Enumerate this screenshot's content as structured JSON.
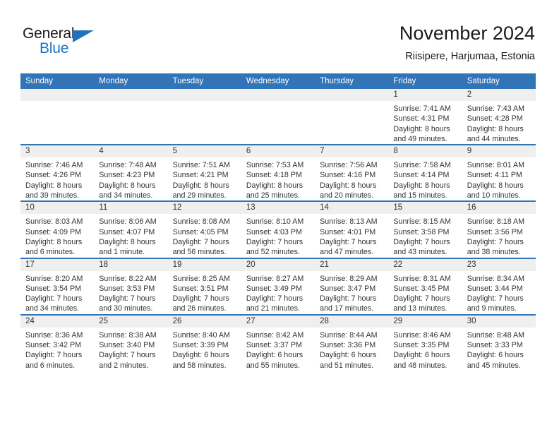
{
  "brand": {
    "name_part1": "General",
    "name_part2": "Blue",
    "triangle_color": "#1e73be"
  },
  "header": {
    "title": "November 2024",
    "subtitle": "Riisipere, Harjumaa, Estonia",
    "header_bg_color": "#3174b8",
    "daynum_band_color": "#efefef"
  },
  "weekday_headers": [
    "Sunday",
    "Monday",
    "Tuesday",
    "Wednesday",
    "Thursday",
    "Friday",
    "Saturday"
  ],
  "weeks": [
    [
      {
        "day": "",
        "empty": true
      },
      {
        "day": "",
        "empty": true
      },
      {
        "day": "",
        "empty": true
      },
      {
        "day": "",
        "empty": true
      },
      {
        "day": "",
        "empty": true
      },
      {
        "day": "1",
        "sunrise": "Sunrise: 7:41 AM",
        "sunset": "Sunset: 4:31 PM",
        "daylight_line1": "Daylight: 8 hours",
        "daylight_line2": "and 49 minutes."
      },
      {
        "day": "2",
        "sunrise": "Sunrise: 7:43 AM",
        "sunset": "Sunset: 4:28 PM",
        "daylight_line1": "Daylight: 8 hours",
        "daylight_line2": "and 44 minutes."
      }
    ],
    [
      {
        "day": "3",
        "sunrise": "Sunrise: 7:46 AM",
        "sunset": "Sunset: 4:26 PM",
        "daylight_line1": "Daylight: 8 hours",
        "daylight_line2": "and 39 minutes."
      },
      {
        "day": "4",
        "sunrise": "Sunrise: 7:48 AM",
        "sunset": "Sunset: 4:23 PM",
        "daylight_line1": "Daylight: 8 hours",
        "daylight_line2": "and 34 minutes."
      },
      {
        "day": "5",
        "sunrise": "Sunrise: 7:51 AM",
        "sunset": "Sunset: 4:21 PM",
        "daylight_line1": "Daylight: 8 hours",
        "daylight_line2": "and 29 minutes."
      },
      {
        "day": "6",
        "sunrise": "Sunrise: 7:53 AM",
        "sunset": "Sunset: 4:18 PM",
        "daylight_line1": "Daylight: 8 hours",
        "daylight_line2": "and 25 minutes."
      },
      {
        "day": "7",
        "sunrise": "Sunrise: 7:56 AM",
        "sunset": "Sunset: 4:16 PM",
        "daylight_line1": "Daylight: 8 hours",
        "daylight_line2": "and 20 minutes."
      },
      {
        "day": "8",
        "sunrise": "Sunrise: 7:58 AM",
        "sunset": "Sunset: 4:14 PM",
        "daylight_line1": "Daylight: 8 hours",
        "daylight_line2": "and 15 minutes."
      },
      {
        "day": "9",
        "sunrise": "Sunrise: 8:01 AM",
        "sunset": "Sunset: 4:11 PM",
        "daylight_line1": "Daylight: 8 hours",
        "daylight_line2": "and 10 minutes."
      }
    ],
    [
      {
        "day": "10",
        "sunrise": "Sunrise: 8:03 AM",
        "sunset": "Sunset: 4:09 PM",
        "daylight_line1": "Daylight: 8 hours",
        "daylight_line2": "and 6 minutes."
      },
      {
        "day": "11",
        "sunrise": "Sunrise: 8:06 AM",
        "sunset": "Sunset: 4:07 PM",
        "daylight_line1": "Daylight: 8 hours",
        "daylight_line2": "and 1 minute."
      },
      {
        "day": "12",
        "sunrise": "Sunrise: 8:08 AM",
        "sunset": "Sunset: 4:05 PM",
        "daylight_line1": "Daylight: 7 hours",
        "daylight_line2": "and 56 minutes."
      },
      {
        "day": "13",
        "sunrise": "Sunrise: 8:10 AM",
        "sunset": "Sunset: 4:03 PM",
        "daylight_line1": "Daylight: 7 hours",
        "daylight_line2": "and 52 minutes."
      },
      {
        "day": "14",
        "sunrise": "Sunrise: 8:13 AM",
        "sunset": "Sunset: 4:01 PM",
        "daylight_line1": "Daylight: 7 hours",
        "daylight_line2": "and 47 minutes."
      },
      {
        "day": "15",
        "sunrise": "Sunrise: 8:15 AM",
        "sunset": "Sunset: 3:58 PM",
        "daylight_line1": "Daylight: 7 hours",
        "daylight_line2": "and 43 minutes."
      },
      {
        "day": "16",
        "sunrise": "Sunrise: 8:18 AM",
        "sunset": "Sunset: 3:56 PM",
        "daylight_line1": "Daylight: 7 hours",
        "daylight_line2": "and 38 minutes."
      }
    ],
    [
      {
        "day": "17",
        "sunrise": "Sunrise: 8:20 AM",
        "sunset": "Sunset: 3:54 PM",
        "daylight_line1": "Daylight: 7 hours",
        "daylight_line2": "and 34 minutes."
      },
      {
        "day": "18",
        "sunrise": "Sunrise: 8:22 AM",
        "sunset": "Sunset: 3:53 PM",
        "daylight_line1": "Daylight: 7 hours",
        "daylight_line2": "and 30 minutes."
      },
      {
        "day": "19",
        "sunrise": "Sunrise: 8:25 AM",
        "sunset": "Sunset: 3:51 PM",
        "daylight_line1": "Daylight: 7 hours",
        "daylight_line2": "and 26 minutes."
      },
      {
        "day": "20",
        "sunrise": "Sunrise: 8:27 AM",
        "sunset": "Sunset: 3:49 PM",
        "daylight_line1": "Daylight: 7 hours",
        "daylight_line2": "and 21 minutes."
      },
      {
        "day": "21",
        "sunrise": "Sunrise: 8:29 AM",
        "sunset": "Sunset: 3:47 PM",
        "daylight_line1": "Daylight: 7 hours",
        "daylight_line2": "and 17 minutes."
      },
      {
        "day": "22",
        "sunrise": "Sunrise: 8:31 AM",
        "sunset": "Sunset: 3:45 PM",
        "daylight_line1": "Daylight: 7 hours",
        "daylight_line2": "and 13 minutes."
      },
      {
        "day": "23",
        "sunrise": "Sunrise: 8:34 AM",
        "sunset": "Sunset: 3:44 PM",
        "daylight_line1": "Daylight: 7 hours",
        "daylight_line2": "and 9 minutes."
      }
    ],
    [
      {
        "day": "24",
        "sunrise": "Sunrise: 8:36 AM",
        "sunset": "Sunset: 3:42 PM",
        "daylight_line1": "Daylight: 7 hours",
        "daylight_line2": "and 6 minutes."
      },
      {
        "day": "25",
        "sunrise": "Sunrise: 8:38 AM",
        "sunset": "Sunset: 3:40 PM",
        "daylight_line1": "Daylight: 7 hours",
        "daylight_line2": "and 2 minutes."
      },
      {
        "day": "26",
        "sunrise": "Sunrise: 8:40 AM",
        "sunset": "Sunset: 3:39 PM",
        "daylight_line1": "Daylight: 6 hours",
        "daylight_line2": "and 58 minutes."
      },
      {
        "day": "27",
        "sunrise": "Sunrise: 8:42 AM",
        "sunset": "Sunset: 3:37 PM",
        "daylight_line1": "Daylight: 6 hours",
        "daylight_line2": "and 55 minutes."
      },
      {
        "day": "28",
        "sunrise": "Sunrise: 8:44 AM",
        "sunset": "Sunset: 3:36 PM",
        "daylight_line1": "Daylight: 6 hours",
        "daylight_line2": "and 51 minutes."
      },
      {
        "day": "29",
        "sunrise": "Sunrise: 8:46 AM",
        "sunset": "Sunset: 3:35 PM",
        "daylight_line1": "Daylight: 6 hours",
        "daylight_line2": "and 48 minutes."
      },
      {
        "day": "30",
        "sunrise": "Sunrise: 8:48 AM",
        "sunset": "Sunset: 3:33 PM",
        "daylight_line1": "Daylight: 6 hours",
        "daylight_line2": "and 45 minutes."
      }
    ]
  ]
}
